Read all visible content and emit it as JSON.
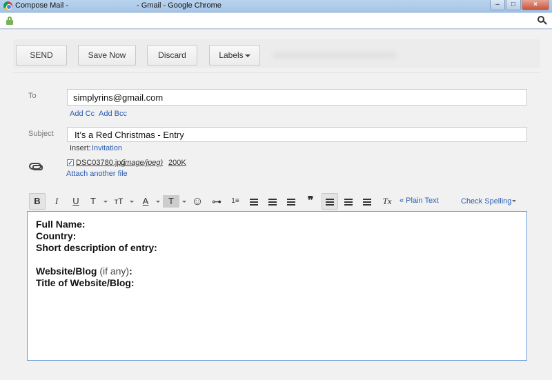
{
  "window": {
    "title_left": "Compose Mail -",
    "title_right": "- Gmail - Google Chrome",
    "minimize": "–",
    "maximize": "□",
    "close": "×"
  },
  "toolbar": {
    "send": "SEND",
    "save_now": "Save Now",
    "discard": "Discard",
    "labels": "Labels"
  },
  "compose": {
    "to_label": "To",
    "to_value": "simplyrins@gmail.com",
    "add_cc": "Add Cc",
    "add_bcc": "Add Bcc",
    "subject_label": "Subject",
    "subject_value": "It’s a Red Christmas - Entry",
    "insert_label": "Insert:",
    "insert_link": "Invitation",
    "attachment_checked": "✓",
    "attachment_name": "DSC03780.jpg",
    "attachment_type": "(image/jpeg)",
    "attachment_size": "200K",
    "attach_another": "Attach another file"
  },
  "format_toolbar": {
    "bold": "B",
    "italic": "I",
    "underline": "U",
    "font": "T",
    "size": "тT",
    "text_color": "A",
    "highlight": "T",
    "emoji": "☺",
    "link": "⊶",
    "numbered": "1≡",
    "quote": "❞",
    "clear": "Tx",
    "plain_text": "« Plain Text",
    "check_spelling": "Check Spelling"
  },
  "body": {
    "line1": "Full Name:",
    "line2": "Country:",
    "line3": "Short description of entry:",
    "line4_bold": "Website/Blog",
    "line4_normal": "(if any)",
    "line4_end": ":",
    "line5": "Title of Website/Blog:"
  }
}
